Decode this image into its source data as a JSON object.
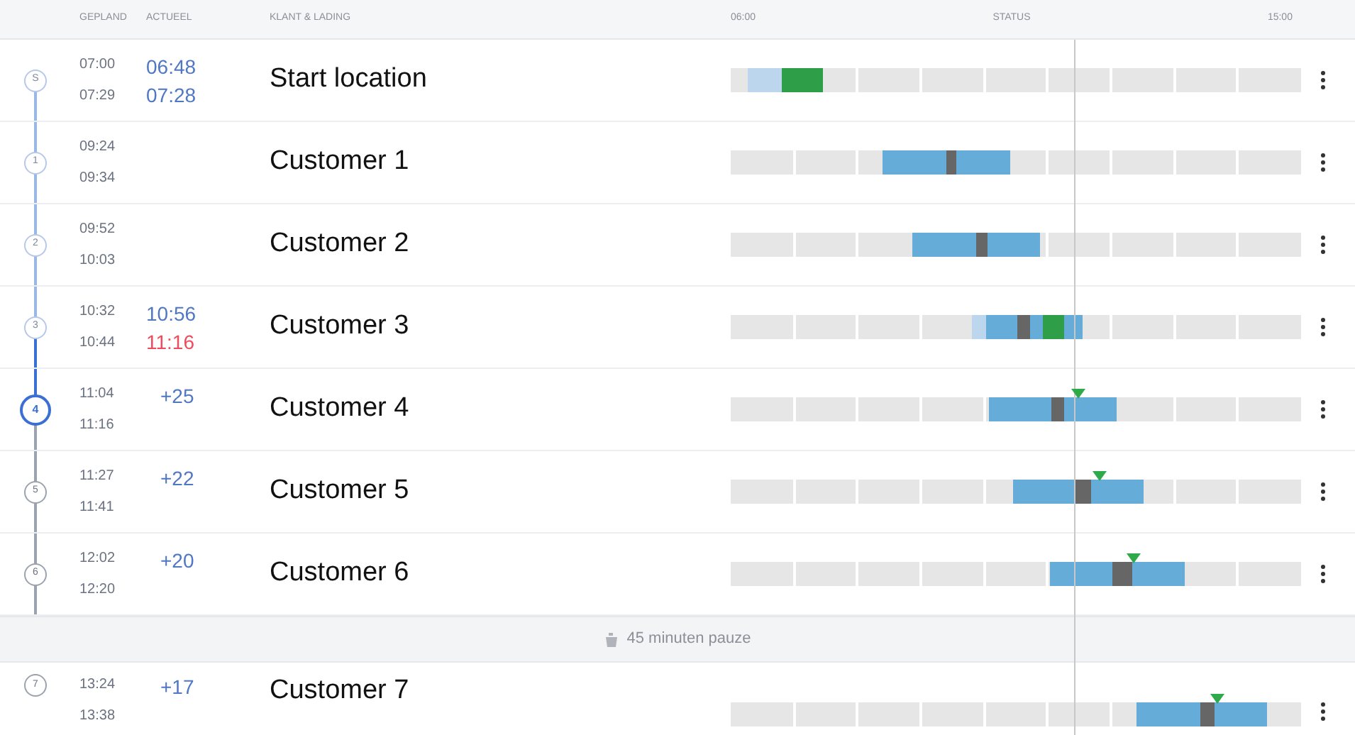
{
  "header": {
    "columns": [
      "GEPLAND",
      "ACTUEEL",
      "KLANT & LADING"
    ],
    "timeline_start": "06:00",
    "status": "STATUS",
    "timeline_end": "15:00"
  },
  "stops": [
    {
      "kind": "start",
      "badge": "S",
      "done": true,
      "current": false,
      "planned": [
        "07:00",
        "07:29"
      ],
      "actual": [
        {
          "text": "06:48",
          "late": false
        },
        {
          "text": "07:28",
          "late": false
        }
      ],
      "name": "Start location"
    },
    {
      "kind": "stop",
      "badge": "1",
      "done": true,
      "current": false,
      "planned": [
        "09:24",
        "09:34"
      ],
      "name": "Customer 1"
    },
    {
      "kind": "stop",
      "badge": "2",
      "done": true,
      "current": false,
      "planned": [
        "09:52",
        "10:03"
      ],
      "name": "Customer 2"
    },
    {
      "kind": "stop",
      "badge": "3",
      "done": true,
      "current": false,
      "planned": [
        "10:32",
        "10:44"
      ],
      "actual": [
        {
          "text": "10:56",
          "late": false
        },
        {
          "text": "11:16",
          "late": true
        }
      ],
      "name": "Customer 3"
    },
    {
      "kind": "stop",
      "badge": "4",
      "done": false,
      "current": true,
      "planned": [
        "11:04",
        "11:16"
      ],
      "delay": "+25",
      "name": "Customer 4"
    },
    {
      "kind": "stop",
      "badge": "5",
      "done": false,
      "current": false,
      "planned": [
        "11:27",
        "11:41"
      ],
      "delay": "+22",
      "name": "Customer 5"
    },
    {
      "kind": "stop",
      "badge": "6",
      "done": false,
      "current": false,
      "planned": [
        "12:02",
        "12:20"
      ],
      "delay": "+20",
      "name": "Customer 6"
    },
    {
      "kind": "pause",
      "label": "45 minuten pauze"
    },
    {
      "kind": "stop",
      "badge": "7",
      "done": false,
      "current": false,
      "planned": [
        "13:24",
        "13:38"
      ],
      "delay": "+17",
      "name": "Customer 7"
    }
  ]
}
